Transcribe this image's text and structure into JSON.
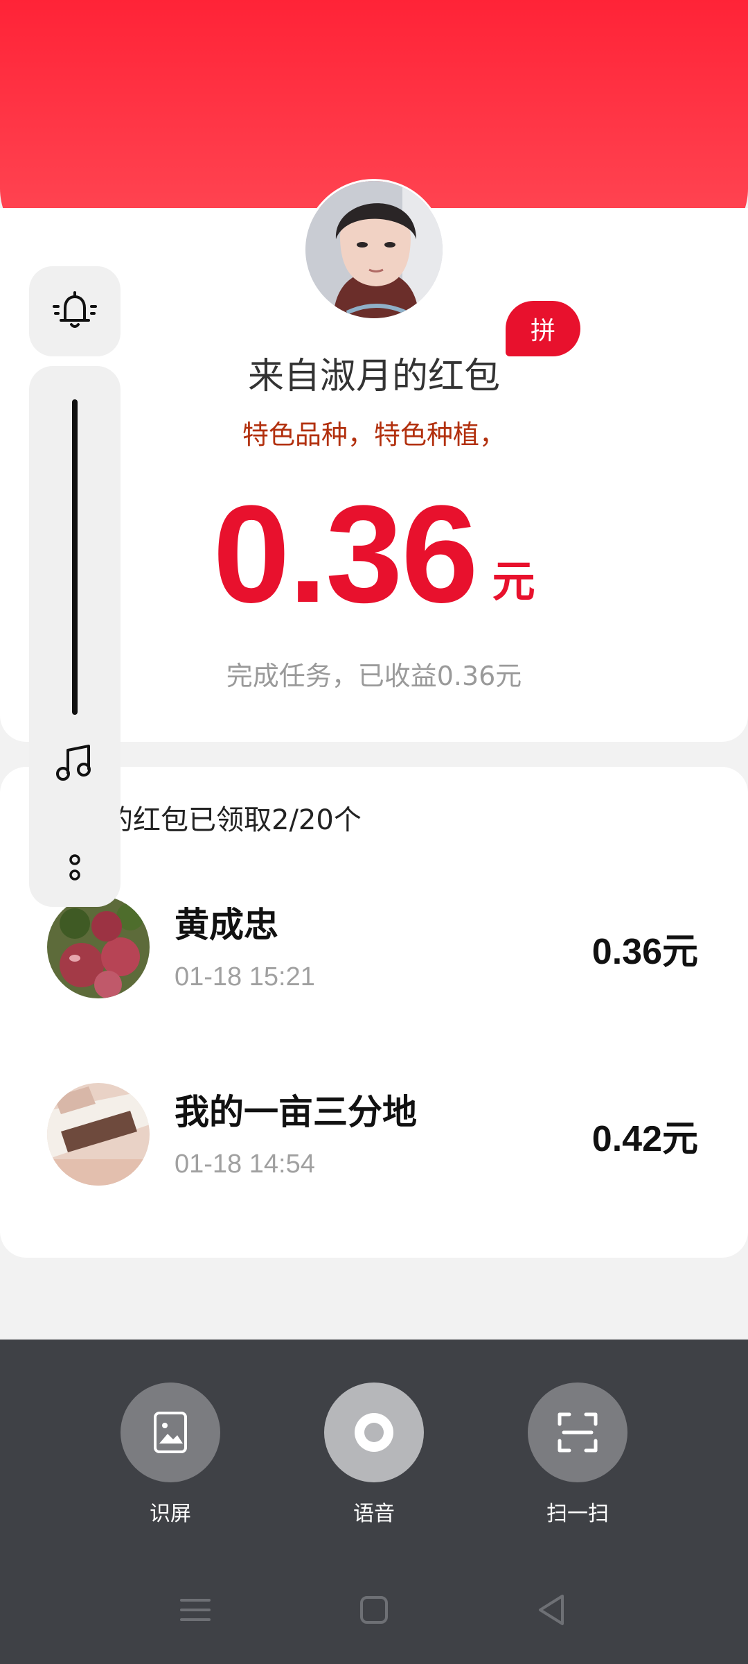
{
  "header": {
    "badge_label": "拼"
  },
  "packet": {
    "title": "来自淑月的红包",
    "subtitle": "特色品种，特色种植，",
    "amount": "0.36",
    "unit": "元",
    "summary": "完成任务，已收益0.36元"
  },
  "claims": {
    "header_text": "淑月的红包已领取2/20个",
    "rows": [
      {
        "name": "黄成忠",
        "time": "01-18 15:21",
        "amount": "0.36元"
      },
      {
        "name": "我的一亩三分地",
        "time": "01-18 14:54",
        "amount": "0.42元"
      }
    ]
  },
  "side_controls": {
    "icons": [
      "bell-icon",
      "music-icon",
      "more-dots-icon"
    ]
  },
  "toolbar": {
    "items": [
      {
        "label": "识屏",
        "icon": "screen-recognize-icon"
      },
      {
        "label": "语音",
        "icon": "voice-icon"
      },
      {
        "label": "扫一扫",
        "icon": "scan-icon"
      }
    ]
  },
  "navigation": {
    "icons": [
      "menu-icon",
      "home-icon",
      "back-icon"
    ]
  },
  "colors": {
    "accent_red": "#e8112d",
    "header_gradient_top": "#ff2337",
    "toolbar_bg": "#3f4146"
  }
}
